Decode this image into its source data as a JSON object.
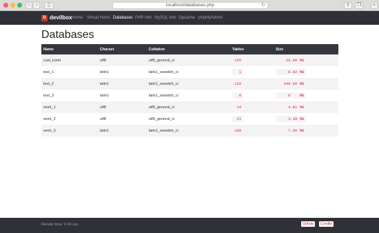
{
  "browser": {
    "address": "localhost/databases.php",
    "add_tab": "+"
  },
  "nav": {
    "logo_letter": "D",
    "brand": "devilbox",
    "links": [
      "Home",
      "Virtual Hosts",
      "Databases",
      "PHP Info",
      "MySQL info",
      "Opcache",
      "phpMyAdmin"
    ],
    "active": "Databases"
  },
  "page": {
    "title": "Databases"
  },
  "table": {
    "headers": [
      "Name",
      "Charset",
      "Collation",
      "Tables",
      "Size"
    ],
    "rows": [
      {
        "name": "cust_hotel",
        "charset": "utf8",
        "collation": "utf8_general_ci",
        "tables": "135",
        "size": "15.00 MB"
      },
      {
        "name": "test_1",
        "charset": "latin1",
        "collation": "latin1_swedish_ci",
        "tables": "1",
        "size": "0.02 MB"
      },
      {
        "name": "test_2",
        "charset": "latin1",
        "collation": "latin1_swedish_ci",
        "tables": "120",
        "size": "149.00 MB"
      },
      {
        "name": "test_3",
        "charset": "latin1",
        "collation": "latin1_swedish_ci",
        "tables": "0",
        "size": "0    MB"
      },
      {
        "name": "work_1",
        "charset": "utf8",
        "collation": "utf8_general_ci",
        "tables": "14",
        "size": "4.81 MB"
      },
      {
        "name": "work_2",
        "charset": "utf8",
        "collation": "utf8_general_ci",
        "tables": "21",
        "size": "3.39 MB"
      },
      {
        "name": "work_3",
        "charset": "latin1",
        "collation": "latin1_swedish_ci",
        "tables": "100",
        "size": "7.00 MB"
      }
    ]
  },
  "footer": {
    "render_time": "Render time: 0.04 sec.",
    "github": "Github",
    "credits": "Credits"
  }
}
